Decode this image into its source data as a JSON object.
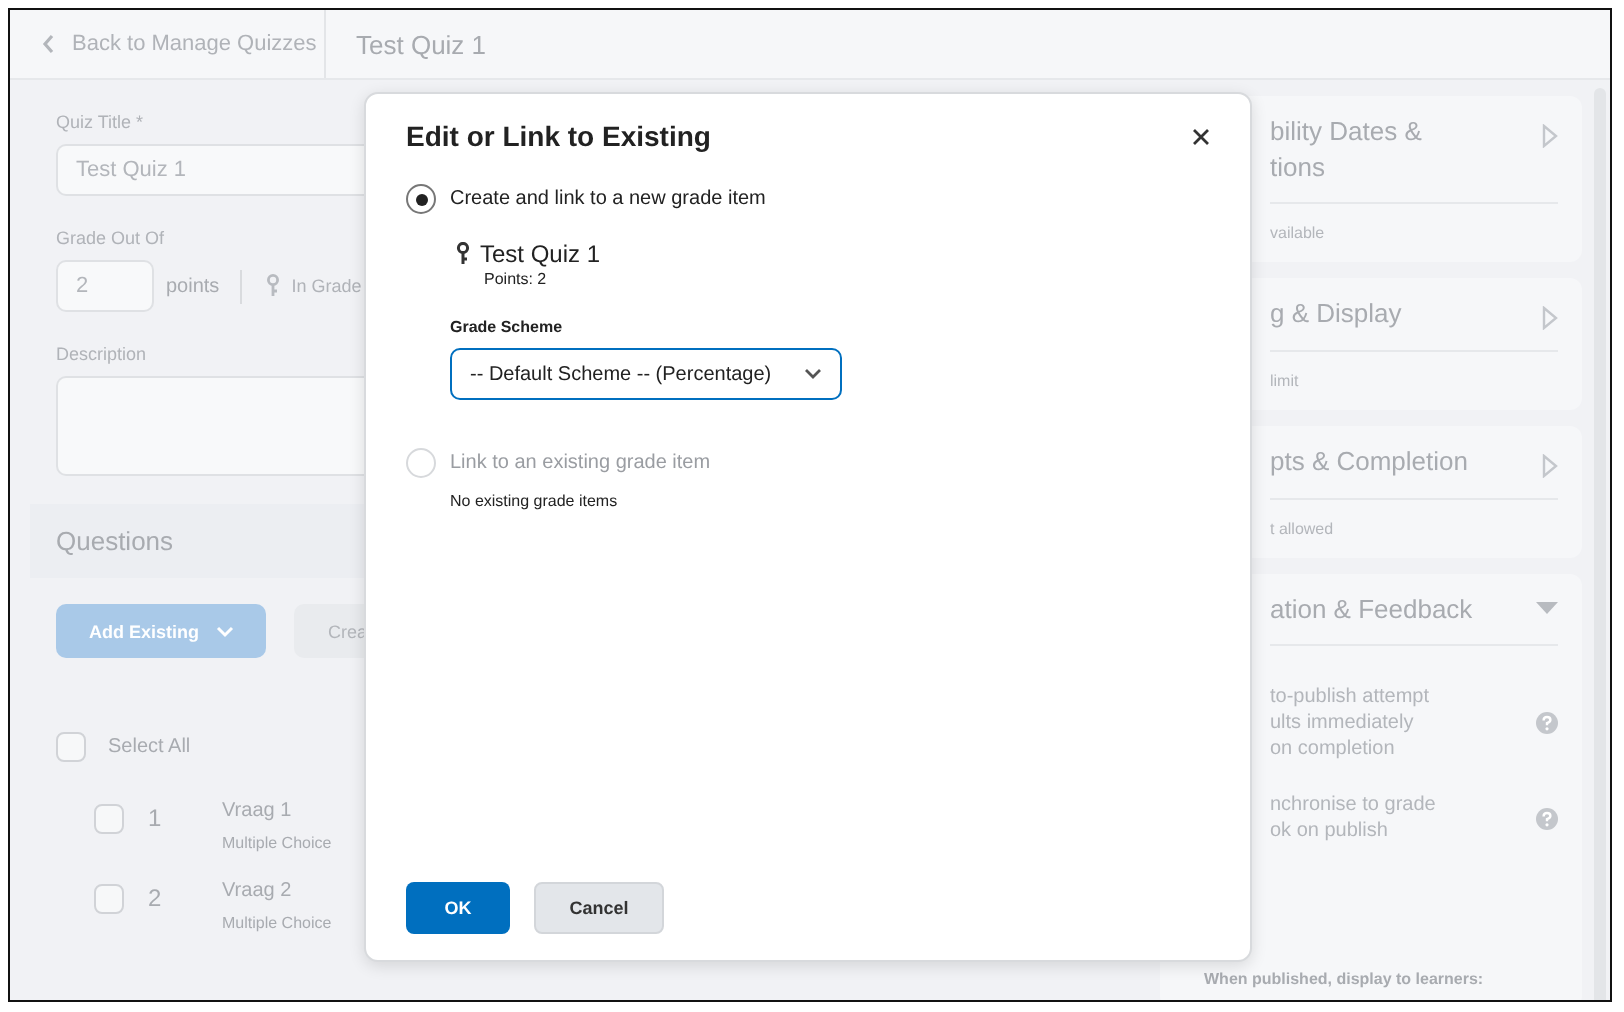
{
  "header": {
    "back_link": "Back to Manage Quizzes",
    "title": "Test Quiz 1"
  },
  "form": {
    "quiz_title_label": "Quiz Title *",
    "quiz_title_value": "Test Quiz 1",
    "grade_label": "Grade Out Of",
    "grade_value": "2",
    "points_label": "points",
    "in_grade_label": "In Grade",
    "description_label": "Description"
  },
  "questions": {
    "heading": "Questions",
    "add_button": "Add Existing",
    "create_button": "Crea",
    "select_all": {
      "label": "Select All",
      "checked": false
    },
    "items": [
      {
        "number": "1",
        "title": "Vraag 1",
        "type": "Multiple Choice",
        "checked": false
      },
      {
        "number": "2",
        "title": "Vraag 2",
        "type": "Multiple Choice",
        "checked": false
      }
    ]
  },
  "settings": {
    "cards": [
      {
        "title": [
          "bility Dates &",
          "tions"
        ],
        "summary": "vailable",
        "expanded": false
      },
      {
        "title": [
          "g & Display"
        ],
        "summary": "limit",
        "expanded": false
      },
      {
        "title": [
          "pts & Completion"
        ],
        "summary": "t allowed",
        "expanded": false
      },
      {
        "title": [
          "ation & Feedback"
        ],
        "expanded": true,
        "options": [
          [
            "to-publish attempt",
            "ults immediately",
            "on completion"
          ],
          [
            "nchronise to grade",
            "ok on publish"
          ]
        ],
        "footer": "When published, display to learners:"
      }
    ]
  },
  "dialog": {
    "title": "Edit or Link to Existing",
    "options": [
      {
        "label": "Create and link to a new grade item",
        "selected": true,
        "disabled": false
      },
      {
        "label": "Link to an existing grade item",
        "selected": false,
        "disabled": true
      }
    ],
    "grade_item": {
      "name": "Test Quiz 1",
      "points": "Points: 2"
    },
    "scheme_label": "Grade Scheme",
    "scheme_value": "-- Default Scheme -- (Percentage)",
    "no_items": "No existing grade items",
    "ok": "OK",
    "cancel": "Cancel"
  }
}
